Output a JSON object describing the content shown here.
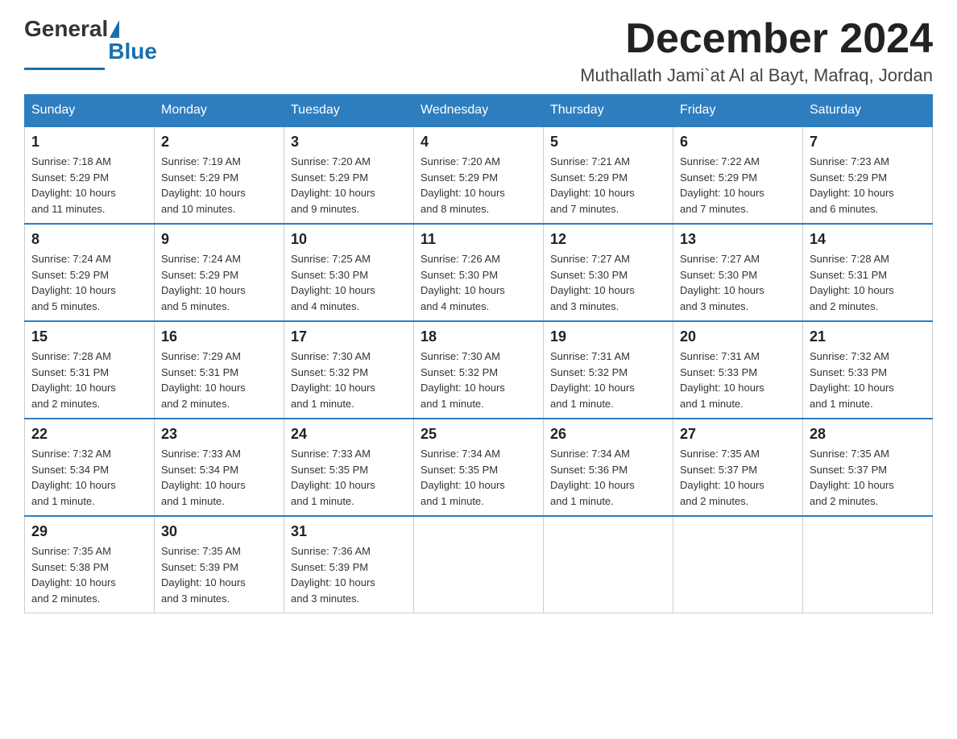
{
  "logo": {
    "general": "General",
    "blue": "Blue"
  },
  "title": {
    "month": "December 2024",
    "location": "Muthallath Jami`at Al al Bayt, Mafraq, Jordan"
  },
  "weekdays": [
    "Sunday",
    "Monday",
    "Tuesday",
    "Wednesday",
    "Thursday",
    "Friday",
    "Saturday"
  ],
  "weeks": [
    [
      {
        "day": "1",
        "sunrise": "7:18 AM",
        "sunset": "5:29 PM",
        "daylight": "10 hours and 11 minutes."
      },
      {
        "day": "2",
        "sunrise": "7:19 AM",
        "sunset": "5:29 PM",
        "daylight": "10 hours and 10 minutes."
      },
      {
        "day": "3",
        "sunrise": "7:20 AM",
        "sunset": "5:29 PM",
        "daylight": "10 hours and 9 minutes."
      },
      {
        "day": "4",
        "sunrise": "7:20 AM",
        "sunset": "5:29 PM",
        "daylight": "10 hours and 8 minutes."
      },
      {
        "day": "5",
        "sunrise": "7:21 AM",
        "sunset": "5:29 PM",
        "daylight": "10 hours and 7 minutes."
      },
      {
        "day": "6",
        "sunrise": "7:22 AM",
        "sunset": "5:29 PM",
        "daylight": "10 hours and 7 minutes."
      },
      {
        "day": "7",
        "sunrise": "7:23 AM",
        "sunset": "5:29 PM",
        "daylight": "10 hours and 6 minutes."
      }
    ],
    [
      {
        "day": "8",
        "sunrise": "7:24 AM",
        "sunset": "5:29 PM",
        "daylight": "10 hours and 5 minutes."
      },
      {
        "day": "9",
        "sunrise": "7:24 AM",
        "sunset": "5:29 PM",
        "daylight": "10 hours and 5 minutes."
      },
      {
        "day": "10",
        "sunrise": "7:25 AM",
        "sunset": "5:30 PM",
        "daylight": "10 hours and 4 minutes."
      },
      {
        "day": "11",
        "sunrise": "7:26 AM",
        "sunset": "5:30 PM",
        "daylight": "10 hours and 4 minutes."
      },
      {
        "day": "12",
        "sunrise": "7:27 AM",
        "sunset": "5:30 PM",
        "daylight": "10 hours and 3 minutes."
      },
      {
        "day": "13",
        "sunrise": "7:27 AM",
        "sunset": "5:30 PM",
        "daylight": "10 hours and 3 minutes."
      },
      {
        "day": "14",
        "sunrise": "7:28 AM",
        "sunset": "5:31 PM",
        "daylight": "10 hours and 2 minutes."
      }
    ],
    [
      {
        "day": "15",
        "sunrise": "7:28 AM",
        "sunset": "5:31 PM",
        "daylight": "10 hours and 2 minutes."
      },
      {
        "day": "16",
        "sunrise": "7:29 AM",
        "sunset": "5:31 PM",
        "daylight": "10 hours and 2 minutes."
      },
      {
        "day": "17",
        "sunrise": "7:30 AM",
        "sunset": "5:32 PM",
        "daylight": "10 hours and 1 minute."
      },
      {
        "day": "18",
        "sunrise": "7:30 AM",
        "sunset": "5:32 PM",
        "daylight": "10 hours and 1 minute."
      },
      {
        "day": "19",
        "sunrise": "7:31 AM",
        "sunset": "5:32 PM",
        "daylight": "10 hours and 1 minute."
      },
      {
        "day": "20",
        "sunrise": "7:31 AM",
        "sunset": "5:33 PM",
        "daylight": "10 hours and 1 minute."
      },
      {
        "day": "21",
        "sunrise": "7:32 AM",
        "sunset": "5:33 PM",
        "daylight": "10 hours and 1 minute."
      }
    ],
    [
      {
        "day": "22",
        "sunrise": "7:32 AM",
        "sunset": "5:34 PM",
        "daylight": "10 hours and 1 minute."
      },
      {
        "day": "23",
        "sunrise": "7:33 AM",
        "sunset": "5:34 PM",
        "daylight": "10 hours and 1 minute."
      },
      {
        "day": "24",
        "sunrise": "7:33 AM",
        "sunset": "5:35 PM",
        "daylight": "10 hours and 1 minute."
      },
      {
        "day": "25",
        "sunrise": "7:34 AM",
        "sunset": "5:35 PM",
        "daylight": "10 hours and 1 minute."
      },
      {
        "day": "26",
        "sunrise": "7:34 AM",
        "sunset": "5:36 PM",
        "daylight": "10 hours and 1 minute."
      },
      {
        "day": "27",
        "sunrise": "7:35 AM",
        "sunset": "5:37 PM",
        "daylight": "10 hours and 2 minutes."
      },
      {
        "day": "28",
        "sunrise": "7:35 AM",
        "sunset": "5:37 PM",
        "daylight": "10 hours and 2 minutes."
      }
    ],
    [
      {
        "day": "29",
        "sunrise": "7:35 AM",
        "sunset": "5:38 PM",
        "daylight": "10 hours and 2 minutes."
      },
      {
        "day": "30",
        "sunrise": "7:35 AM",
        "sunset": "5:39 PM",
        "daylight": "10 hours and 3 minutes."
      },
      {
        "day": "31",
        "sunrise": "7:36 AM",
        "sunset": "5:39 PM",
        "daylight": "10 hours and 3 minutes."
      },
      null,
      null,
      null,
      null
    ]
  ],
  "labels": {
    "sunrise": "Sunrise: ",
    "sunset": "Sunset: ",
    "daylight": "Daylight: "
  }
}
